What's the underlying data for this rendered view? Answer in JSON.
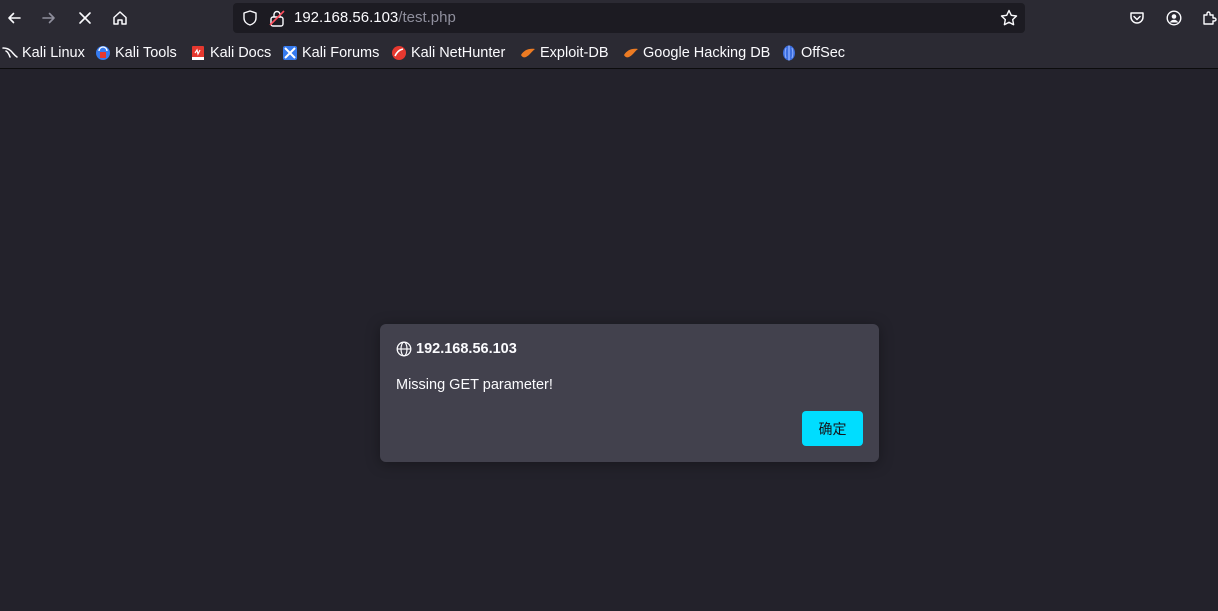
{
  "toolbar": {
    "back_icon": "back-arrow-icon",
    "forward_icon": "forward-arrow-icon",
    "stop_icon": "stop-x-icon",
    "home_icon": "home-icon"
  },
  "urlbar": {
    "host": "192.168.56.103",
    "path": "/test.php"
  },
  "bookmarks": [
    {
      "label": "Kali Linux",
      "icon": "kali-dragon-icon"
    },
    {
      "label": "Kali Tools",
      "icon": "kali-tools-icon"
    },
    {
      "label": "Kali Docs",
      "icon": "kali-docs-icon"
    },
    {
      "label": "Kali Forums",
      "icon": "kali-forums-icon"
    },
    {
      "label": "Kali NetHunter",
      "icon": "kali-nethunter-icon"
    },
    {
      "label": "Exploit-DB",
      "icon": "exploit-db-icon"
    },
    {
      "label": "Google Hacking DB",
      "icon": "ghdb-icon"
    },
    {
      "label": "OffSec",
      "icon": "offsec-icon"
    }
  ],
  "dialog": {
    "origin": "192.168.56.103",
    "message": "Missing GET parameter!",
    "ok_label": "确定"
  },
  "colors": {
    "page_bg": "#23222b",
    "toolbar_bg": "#2b2a33",
    "urlbar_bg": "#1c1b22",
    "dialog_bg": "#42414d",
    "accent": "#00ddff"
  }
}
